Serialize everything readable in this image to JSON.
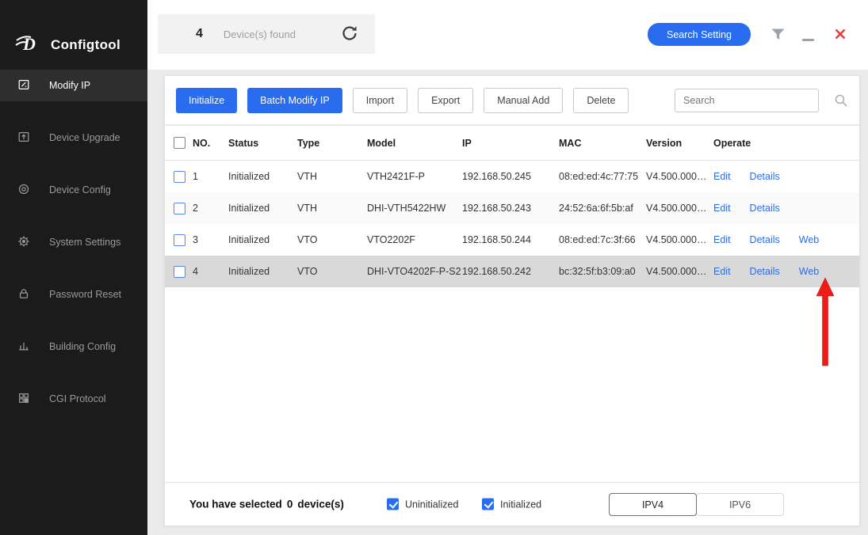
{
  "app": {
    "logo_text": "Configtool",
    "accent_color": "#2a6cf0",
    "close_color": "#e23c3c",
    "arrow_color": "#ed1c16",
    "selected_row_color": "#d9d9d9"
  },
  "sidebar": {
    "items": [
      {
        "label": "Modify IP",
        "icon": "modify-ip-icon",
        "active": true
      },
      {
        "label": "Device Upgrade",
        "icon": "device-upgrade-icon",
        "active": false
      },
      {
        "label": "Device Config",
        "icon": "device-config-icon",
        "active": false
      },
      {
        "label": "System Settings",
        "icon": "system-settings-icon",
        "active": false
      },
      {
        "label": "Password Reset",
        "icon": "password-reset-icon",
        "active": false
      },
      {
        "label": "Building Config",
        "icon": "building-config-icon",
        "active": false
      },
      {
        "label": "CGI Protocol",
        "icon": "cgi-protocol-icon",
        "active": false
      }
    ]
  },
  "header": {
    "device_count": "4",
    "device_found_label": "Device(s) found",
    "search_setting_label": "Search Setting"
  },
  "toolbar": {
    "initialize": "Initialize",
    "batch_modify_ip": "Batch Modify IP",
    "import": "Import",
    "export": "Export",
    "manual_add": "Manual Add",
    "delete": "Delete",
    "search_placeholder": "Search"
  },
  "table": {
    "columns": [
      "NO.",
      "Status",
      "Type",
      "Model",
      "IP",
      "MAC",
      "Version",
      "Operate"
    ],
    "rows": [
      {
        "no": "1",
        "status": "Initialized",
        "type": "VTH",
        "model": "VTH2421F-P",
        "ip": "192.168.50.245",
        "mac": "08:ed:ed:4c:77:75",
        "version": "V4.500.000…",
        "ops": [
          "Edit",
          "Details"
        ]
      },
      {
        "no": "2",
        "status": "Initialized",
        "type": "VTH",
        "model": "DHI-VTH5422HW",
        "ip": "192.168.50.243",
        "mac": "24:52:6a:6f:5b:af",
        "version": "V4.500.000…",
        "ops": [
          "Edit",
          "Details"
        ]
      },
      {
        "no": "3",
        "status": "Initialized",
        "type": "VTO",
        "model": "VTO2202F",
        "ip": "192.168.50.244",
        "mac": "08:ed:ed:7c:3f:66",
        "version": "V4.500.000…",
        "ops": [
          "Edit",
          "Details",
          "Web"
        ]
      },
      {
        "no": "4",
        "status": "Initialized",
        "type": "VTO",
        "model": "DHI-VTO4202F-P-S2",
        "ip": "192.168.50.242",
        "mac": "bc:32:5f:b3:09:a0",
        "version": "V4.500.000…",
        "ops": [
          "Edit",
          "Details",
          "Web"
        ],
        "selected": true
      }
    ]
  },
  "footer": {
    "selected_prefix": "You have selected",
    "selected_count": "0",
    "selected_suffix": "device(s)",
    "uninitialized_label": "Uninitialized",
    "initialized_label": "Initialized",
    "ipv4_label": "IPV4",
    "ipv6_label": "IPV6"
  }
}
